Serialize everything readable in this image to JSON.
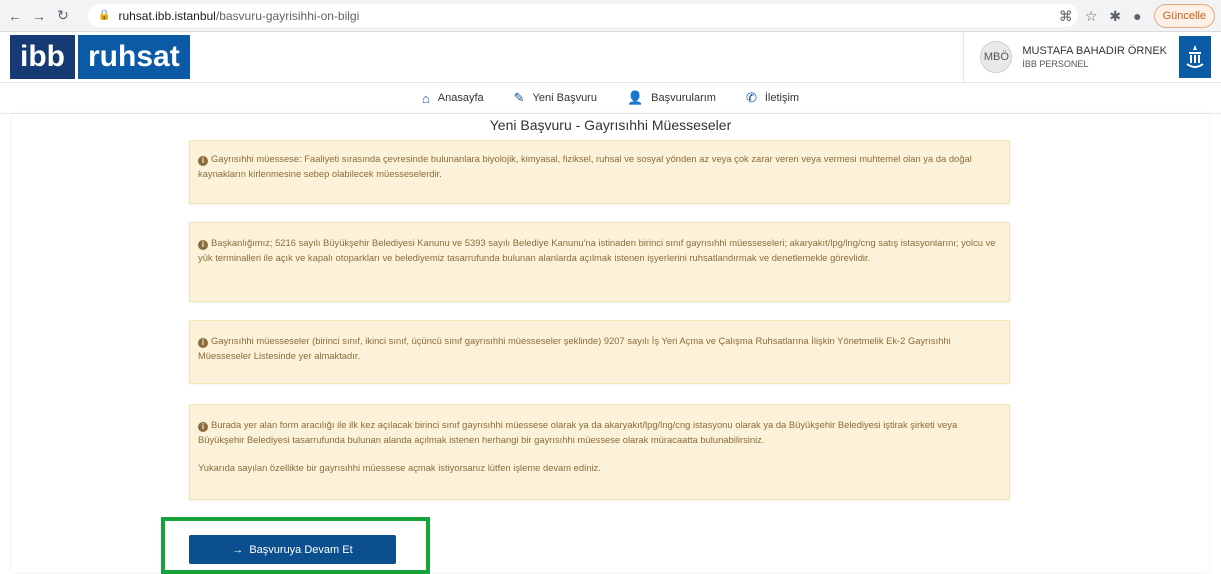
{
  "browser": {
    "url_host": "ruhsat.ibb.istanbul",
    "url_path": "/basvuru-gayrisihhi-on-bilgi",
    "update_label": "Güncelle"
  },
  "header": {
    "logo_left": "ibb",
    "logo_right": "ruhsat",
    "user_initials": "MBÖ",
    "user_name": "MUSTAFA BAHADIR ÖRNEK",
    "user_role": "İBB PERSONEL"
  },
  "nav": {
    "items": [
      {
        "label": "Anasayfa",
        "icon": "home-icon"
      },
      {
        "label": "Yeni Başvuru",
        "icon": "edit-icon"
      },
      {
        "label": "Başvurularım",
        "icon": "user-icon"
      },
      {
        "label": "İletişim",
        "icon": "phone-icon"
      }
    ]
  },
  "page": {
    "title": "Yeni Başvuru - Gayrısıhhi Müesseseler",
    "alerts": [
      {
        "text": "Gayrısıhhi müessese: Faaliyeti sırasında çevresinde bulunanlara biyolojik, kimyasal, fiziksel, ruhsal ve sosyal yönden az veya çok zarar veren veya vermesi muhtemel olan ya da doğal kaynakların kirlenmesine sebep olabilecek müesseselerdir."
      },
      {
        "text": "Başkanlığımız; 5216 sayılı Büyükşehir Belediyesi Kanunu ve 5393 sayılı Belediye Kanunu'na istinaden birinci sınıf gayrısıhhi müesseseleri; akaryakıt/lpg/lng/cng satış istasyonlarını; yolcu ve yük terminalleri ile açık ve kapalı otoparkları ve belediyemiz tasarrufunda bulunan alanlarda açılmak istenen işyerlerini ruhsatlandırmak ve denetlemekle görevlidir."
      },
      {
        "text": "Gayrısıhhi müesseseler (birinci sınıf, ikinci sınıf, üçüncü sınıf gayrısıhhi müesseseler şeklinde) 9207 sayılı İş Yeri Açma ve Çalışma Ruhsatlarına İlişkin Yönetmelik Ek-2 Gayrısıhhi Müesseseler Listesinde yer almaktadır."
      },
      {
        "text": "Burada yer alan form aracılığı ile ilk kez açılacak birinci sınıf gayrısıhhi müessese olarak ya da akaryakıt/lpg/lng/cng istasyonu olarak ya da Büyükşehir Belediyesi iştirak şirketi veya Büyükşehir Belediyesi tasarrufunda bulunan alanda açılmak istenen herhangi bir gayrısıhhi müessese olarak müracaatta bulunabilirsiniz.",
        "text2": "Yukarıda sayılan özellikte bir gayrısıhhi müessese açmak istiyorsanız lütfen işleme devam ediniz."
      }
    ],
    "continue_label": "Başvuruya Devam Et"
  },
  "colors": {
    "brand_dark": "#153a74",
    "brand": "#0a5aa5",
    "alert_bg": "#fcf2d9",
    "alert_text": "#8a6d3b",
    "highlight": "#17a23a"
  }
}
